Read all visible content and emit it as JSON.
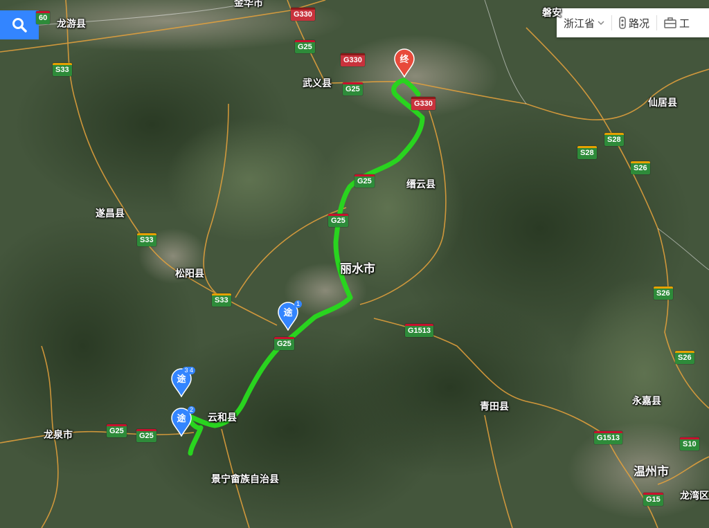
{
  "toolbar": {
    "province_label": "浙江省",
    "traffic_label": "路况",
    "tools_label": "工"
  },
  "colors": {
    "route": "#29d41f",
    "search_button": "#3385ff",
    "end_marker": "#e84a3b",
    "waypoint_marker": "#3385ff"
  },
  "markers": {
    "end": "终",
    "waypoint": "途",
    "waypoint1_num": "1",
    "waypoint2_num": "2",
    "waypoint34_num": "3 4"
  },
  "cities": {
    "jinhua": "金华市",
    "longyou": "龙游县",
    "panan": "磐安",
    "wuyi": "武义县",
    "xianju": "仙居县",
    "jinyun": "缙云县",
    "suichang": "遂昌县",
    "lishui": "丽水市",
    "songyang": "松阳县",
    "yunhe": "云和县",
    "longquan": "龙泉市",
    "jingning": "景宁畲族自治县",
    "qingtian": "青田县",
    "yongjia": "永嘉县",
    "wenzhou": "温州市",
    "longwan": "龙湾区"
  },
  "roads": {
    "g330a": "G330",
    "g330b": "G330",
    "g330c": "G330",
    "g25a": "G25",
    "g25b": "G25",
    "g25c": "G25",
    "g25d": "G25",
    "g25e": "G25",
    "g25f": "G25",
    "g25g": "G25",
    "g60": "60",
    "s33a": "S33",
    "s33b": "S33",
    "s33c": "S33",
    "s28a": "S28",
    "s28b": "S28",
    "s26a": "S26",
    "s26b": "S26",
    "s26c": "S26",
    "g1513a": "G1513",
    "g1513b": "G1513",
    "s10": "S10",
    "g15": "G15"
  }
}
